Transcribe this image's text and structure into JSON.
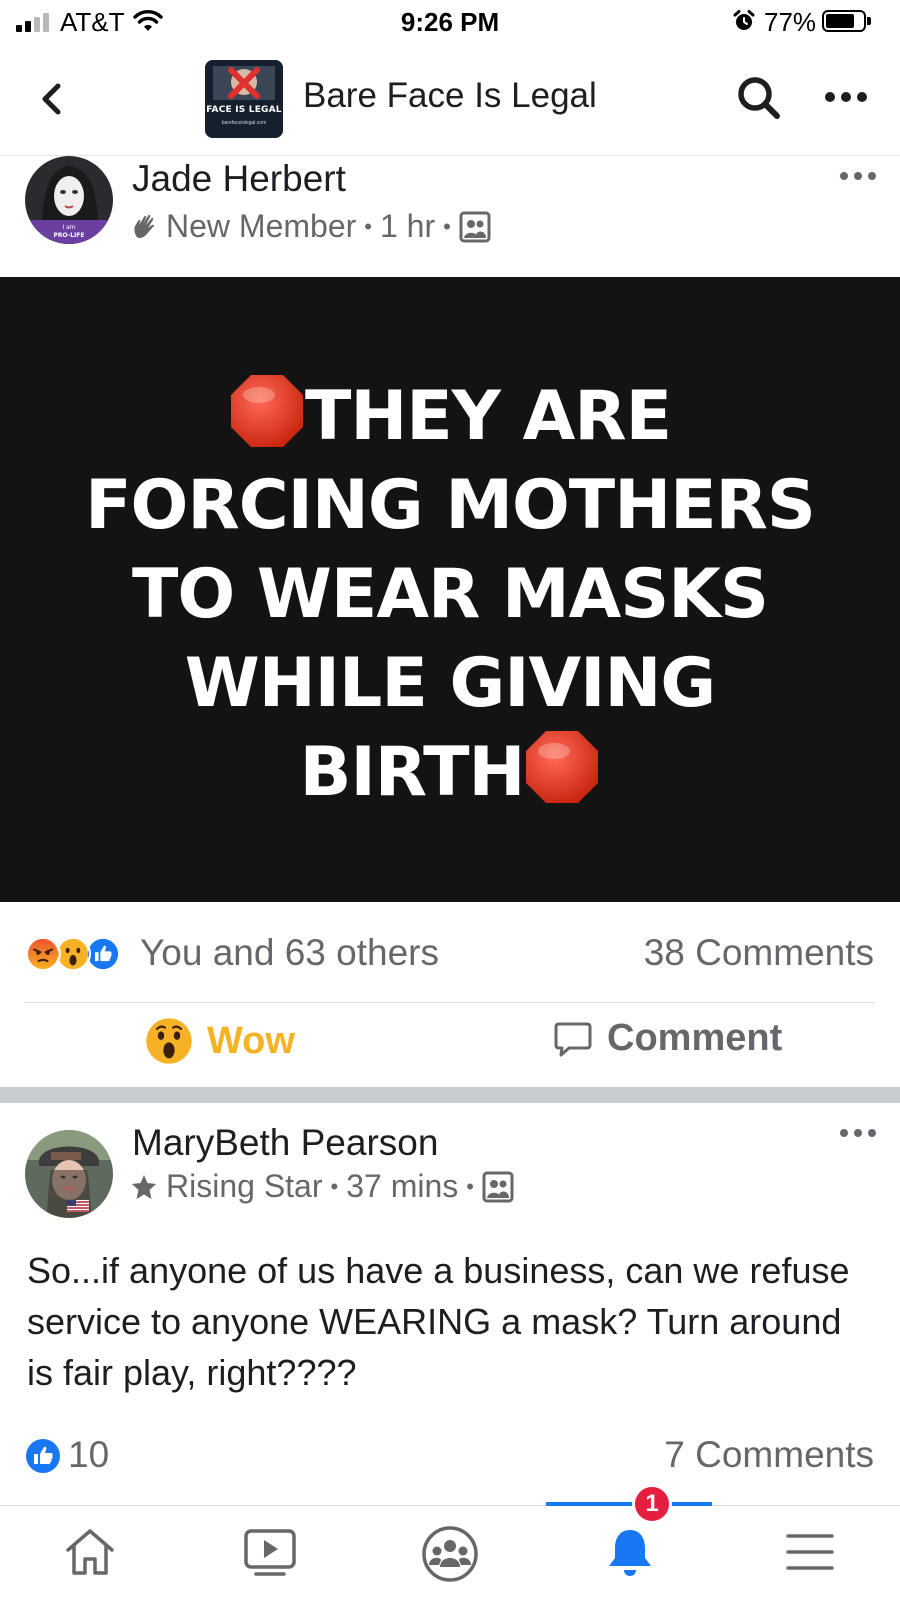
{
  "status_bar": {
    "carrier": "AT&T",
    "time": "9:26 PM",
    "battery_percent": "77%",
    "battery_level": 0.77,
    "signal_bars_active": 2,
    "signal_bars_total": 4
  },
  "nav": {
    "back_icon": "chevron-left-icon",
    "group_name": "Bare Face Is Legal",
    "group_thumb_text": "FACE IS LEGAL",
    "group_thumb_subtext": "barefaceislegal.com",
    "search_icon": "search-icon",
    "more_icon": "more-horizontal-icon"
  },
  "posts": [
    {
      "author": "Jade Herbert",
      "badge_icon": "new-member-hand-icon",
      "badge": "New Member",
      "time": "1 hr",
      "audience_icon": "group-members-icon",
      "avatar_text": "I am PRO-LIFE",
      "image_text_lines": [
        "THEY ARE",
        "FORCING MOTHERS",
        "TO WEAR MASKS",
        "WHILE GIVING",
        "BIRTH"
      ],
      "image_emoji": "stop-sign-icon",
      "reaction_types": [
        "angry",
        "wow",
        "like"
      ],
      "reactions_summary": "You and 63 others",
      "comments": "38 Comments",
      "user_reaction": "Wow",
      "comment_action": "Comment"
    },
    {
      "author": "MaryBeth Pearson",
      "badge_icon": "rising-star-icon",
      "badge": "Rising Star",
      "time": "37 mins",
      "audience_icon": "group-members-icon",
      "text": "So...if anyone of us have a business, can we refuse service to anyone WEARING a mask? Turn around is fair play, right????",
      "likes": "10",
      "comments": "7 Comments"
    }
  ],
  "tab_bar": {
    "tabs": [
      "home-icon",
      "watch-icon",
      "groups-icon",
      "notifications-bell-icon",
      "menu-icon"
    ],
    "active_tab": "notifications-bell-icon",
    "notification_badge": "1"
  },
  "colors": {
    "facebook_blue": "#1877f2",
    "wow_yellow": "#f7b125",
    "badge_red": "#e41e3f",
    "secondary_text": "#65676b"
  }
}
